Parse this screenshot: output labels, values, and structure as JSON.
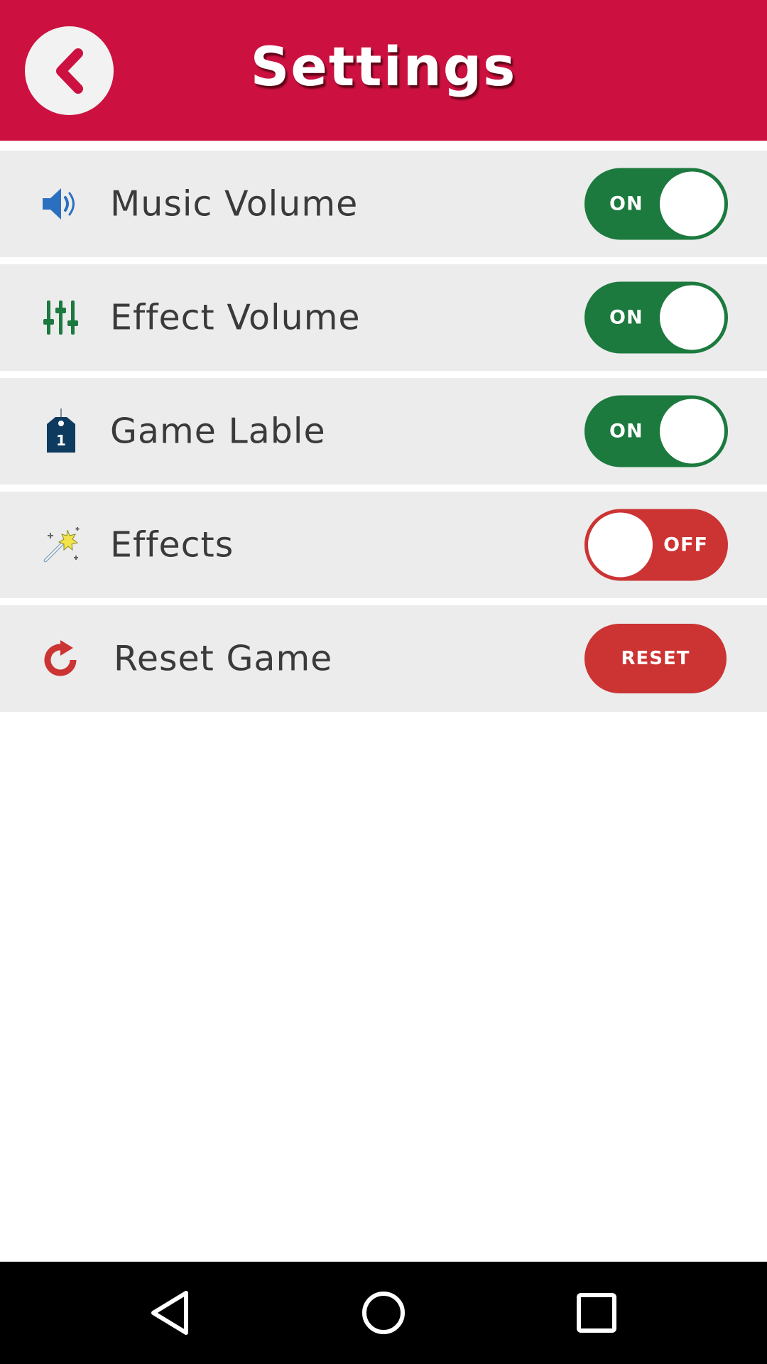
{
  "header": {
    "title": "Settings",
    "back_icon": "chevron-left-icon"
  },
  "settings": {
    "items": [
      {
        "icon": "speaker-volume-icon",
        "label": "Music Volume",
        "control": "toggle",
        "state": "on",
        "state_label": "ON"
      },
      {
        "icon": "sliders-icon",
        "label": "Effect Volume",
        "control": "toggle",
        "state": "on",
        "state_label": "ON"
      },
      {
        "icon": "tag-icon",
        "label": "Game Lable",
        "control": "toggle",
        "state": "on",
        "state_label": "ON",
        "icon_text": "1"
      },
      {
        "icon": "magic-wand-icon",
        "label": "Effects",
        "control": "toggle",
        "state": "off",
        "state_label": "OFF"
      },
      {
        "icon": "refresh-icon",
        "label": "Reset Game",
        "control": "button",
        "button_label": "RESET"
      }
    ]
  },
  "nav_bar": {
    "back_icon": "nav-back-icon",
    "home_icon": "nav-home-icon",
    "recents_icon": "nav-recents-icon"
  },
  "colors": {
    "header": "#cc1141",
    "toggle_on": "#1c7a3e",
    "toggle_off": "#cc3333",
    "row_background": "#ececec",
    "nav_bar": "#000000"
  }
}
